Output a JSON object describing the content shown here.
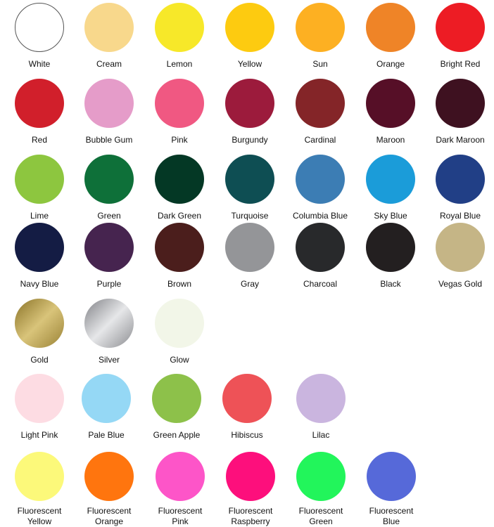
{
  "rows": [
    {
      "swatches": [
        {
          "name": "White",
          "color": "#FFFFFF",
          "outline": true
        },
        {
          "name": "Cream",
          "color": "#F8D88C"
        },
        {
          "name": "Lemon",
          "color": "#F7E829"
        },
        {
          "name": "Yellow",
          "color": "#FDCB10"
        },
        {
          "name": "Sun",
          "color": "#FDB022"
        },
        {
          "name": "Orange",
          "color": "#EF8427"
        },
        {
          "name": "Bright Red",
          "color": "#ED1C24"
        }
      ]
    },
    {
      "swatches": [
        {
          "name": "Red",
          "color": "#D11F2B"
        },
        {
          "name": "Bubble Gum",
          "color": "#E59CC9"
        },
        {
          "name": "Pink",
          "color": "#F05882"
        },
        {
          "name": "Burgundy",
          "color": "#9C1B3C"
        },
        {
          "name": "Cardinal",
          "color": "#842528"
        },
        {
          "name": "Maroon",
          "color": "#560F27"
        },
        {
          "name": "Dark Maroon",
          "color": "#3E1120"
        }
      ]
    },
    {
      "swatches": [
        {
          "name": "Lime",
          "color": "#8DC63F"
        },
        {
          "name": "Green",
          "color": "#0E7039"
        },
        {
          "name": "Dark Green",
          "color": "#043825"
        },
        {
          "name": "Turquoise",
          "color": "#0E4E53"
        },
        {
          "name": "Columbia Blue",
          "color": "#3C7DB4"
        },
        {
          "name": "Sky Blue",
          "color": "#1B9CD9"
        },
        {
          "name": "Royal Blue",
          "color": "#213F86"
        }
      ]
    },
    {
      "swatches": [
        {
          "name": "Navy Blue",
          "color": "#141C44"
        },
        {
          "name": "Purple",
          "color": "#46244F"
        },
        {
          "name": "Brown",
          "color": "#4B1E1C"
        },
        {
          "name": "Gray",
          "color": "#949598"
        },
        {
          "name": "Charcoal",
          "color": "#28292B"
        },
        {
          "name": "Black",
          "color": "#231F20"
        },
        {
          "name": "Vegas Gold",
          "color": "#C5B586"
        }
      ]
    },
    {
      "swatches": [
        {
          "name": "Gold",
          "color": "#B09A4C",
          "gradient": [
            "#8A7328",
            "#D9C47A",
            "#9A8236"
          ]
        },
        {
          "name": "Silver",
          "color": "#A9AAAD",
          "gradient": [
            "#808186",
            "#E6E7E9",
            "#8C8D91"
          ]
        },
        {
          "name": "Glow",
          "color": "#F2F6E8"
        }
      ]
    },
    {
      "swatches": [
        {
          "name": "Light Pink",
          "color": "#FDDCE3"
        },
        {
          "name": "Pale Blue",
          "color": "#95D8F5"
        },
        {
          "name": "Green Apple",
          "color": "#8DC14A"
        },
        {
          "name": "Hibiscus",
          "color": "#EE5257"
        },
        {
          "name": "Lilac",
          "color": "#CAB5DF"
        }
      ]
    },
    {
      "swatches": [
        {
          "name": "Fluorescent Yellow",
          "line1": "Fluorescent",
          "line2": "Yellow",
          "color": "#FCF97A"
        },
        {
          "name": "Fluorescent Orange",
          "line1": "Fluorescent",
          "line2": "Orange",
          "color": "#FF750E"
        },
        {
          "name": "Fluorescent Pink",
          "line1": "Fluorescent",
          "line2": "Pink",
          "color": "#FD55C8"
        },
        {
          "name": "Fluorescent Raspberry",
          "line1": "Fluorescent",
          "line2": "Raspberry",
          "color": "#FD0F7C"
        },
        {
          "name": "Fluorescent Green",
          "line1": "Fluorescent",
          "line2": "Green",
          "color": "#22F55B"
        },
        {
          "name": "Fluorescent Blue",
          "line1": "Fluorescent",
          "line2": "Blue",
          "color": "#5669D9"
        }
      ]
    }
  ]
}
